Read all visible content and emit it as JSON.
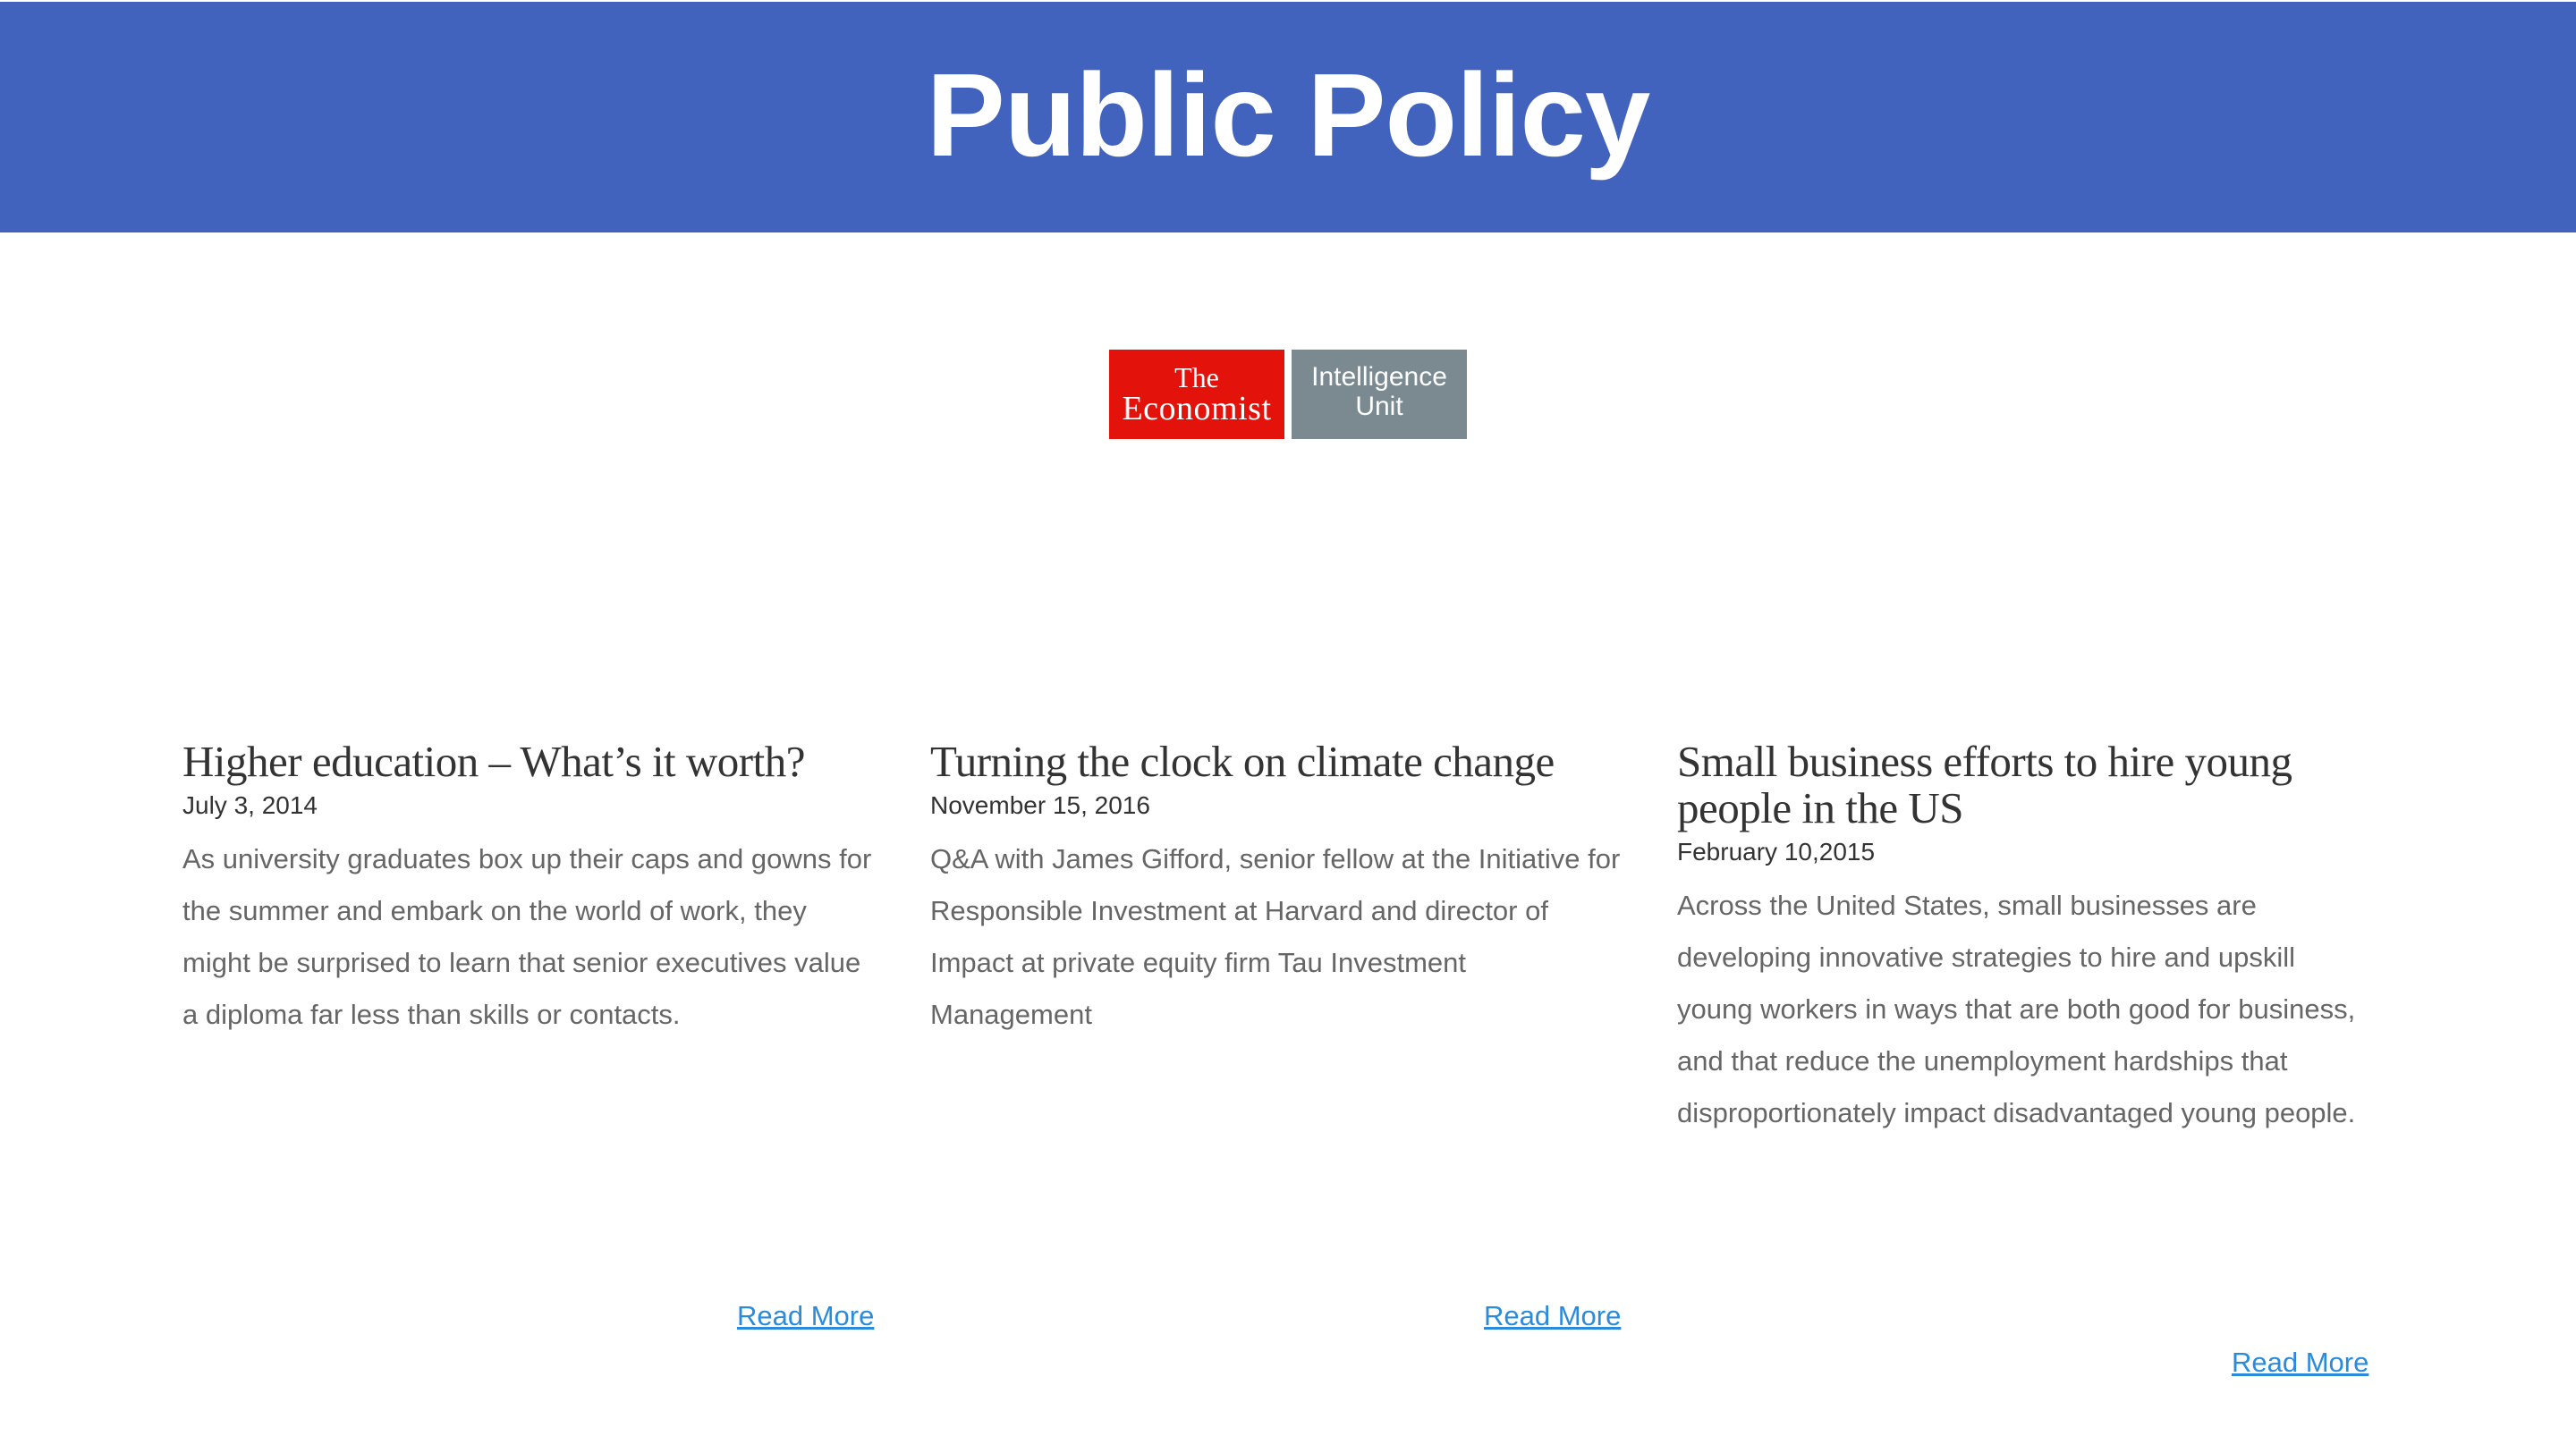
{
  "header": {
    "title": "Public Policy",
    "background_color": "#4163be"
  },
  "logo": {
    "left_line1": "The",
    "left_line2": "Economist",
    "right_line1": "Intelligence",
    "right_line2": "Unit",
    "left_color": "#e3120b",
    "right_color": "#7b8a91"
  },
  "articles": [
    {
      "title": "Higher education – What’s it worth?",
      "date": "July 3, 2014",
      "summary": "As university graduates box up their caps and gowns for the summer and embark on the world of work, they might be surprised to learn that senior executives value a diploma far less than skills or contacts.",
      "link_label": "Read More"
    },
    {
      "title": "Turning the clock on climate change",
      "date": "November 15, 2016",
      "summary": "Q&A with James Gifford, senior fellow at the Initiative for Responsible Investment at Harvard and director of Impact at private equity firm Tau Investment Management",
      "link_label": "Read More"
    },
    {
      "title": "Small business efforts to hire young people in the US",
      "date": "February 10,2015",
      "summary": "Across the United States, small businesses are developing innovative strategies to hire and upskill young workers in ways that are both good for business, and that reduce the unemployment hardships that disproportionately impact disadvantaged young people.",
      "link_label": "Read More"
    }
  ],
  "link_color": "#2a8bdb"
}
